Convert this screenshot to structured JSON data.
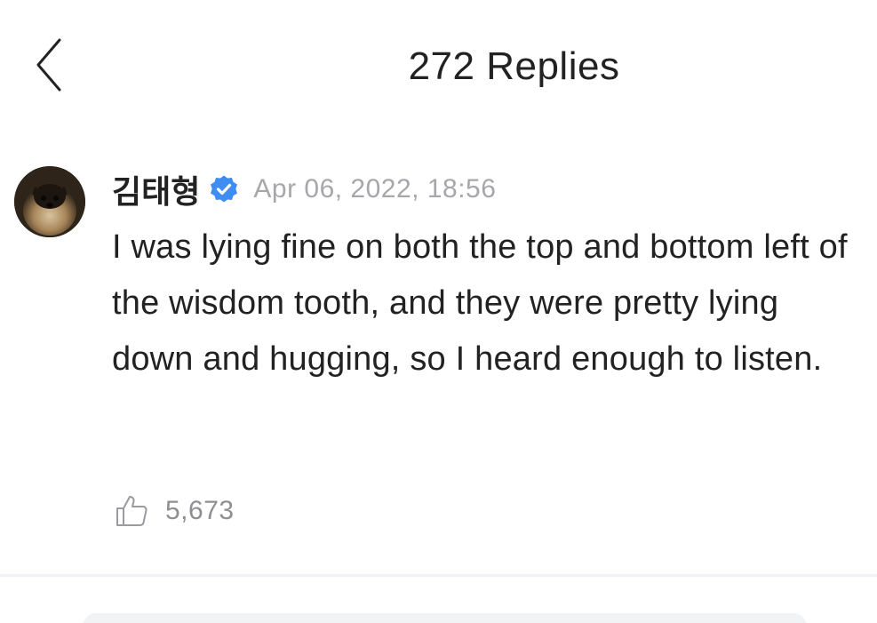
{
  "header": {
    "back_icon": "chevron-left-icon",
    "title": "272 Replies"
  },
  "comment": {
    "author": "김태형",
    "verified_icon": "verified-badge-icon",
    "timestamp": "Apr 06, 2022, 18:56",
    "body": "I was lying fine on both the top and bottom left of the wisdom tooth, and they were pretty lying down and hugging, so I heard enough to listen.",
    "like_icon": "thumbs-up-icon",
    "like_count": "5,673"
  },
  "colors": {
    "text": "#222222",
    "muted": "#a7a7ab",
    "verified": "#3f8cf3",
    "divider": "#eef1f5"
  }
}
